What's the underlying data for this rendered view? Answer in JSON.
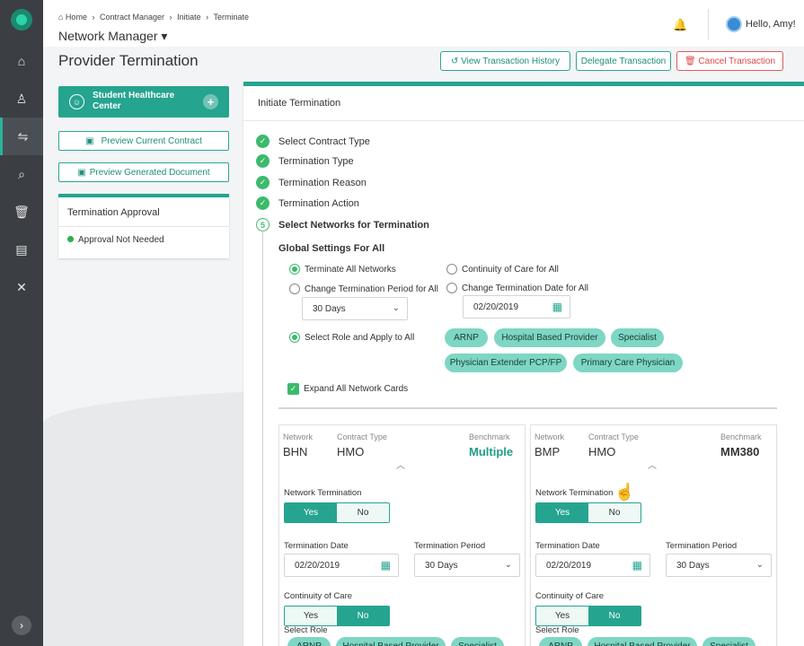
{
  "rail": {
    "items": [
      {
        "icon": "home-icon",
        "glyph": "⌂"
      },
      {
        "icon": "network-icon",
        "glyph": "♙"
      },
      {
        "icon": "transfer-icon",
        "glyph": "⇋"
      },
      {
        "icon": "search-icon",
        "glyph": "⌕"
      },
      {
        "icon": "trash-icon",
        "glyph": "🗑"
      },
      {
        "icon": "document-icon",
        "glyph": "▤"
      },
      {
        "icon": "tools-icon",
        "glyph": "✕"
      }
    ],
    "expand_glyph": "›"
  },
  "header": {
    "breadcrumb": [
      "⌂ Home",
      "›",
      "Contract Manager",
      "›",
      "Initiate",
      "›",
      "Terminate"
    ],
    "network_title": "Network Manager ▾",
    "greeting": "Hello, Amy!"
  },
  "page": {
    "title": "Provider Termination",
    "buttons": {
      "history": "↺  View Transaction History",
      "delegate": "Delegate Transaction",
      "cancel": "🗑  Cancel Transaction"
    }
  },
  "sidebar": {
    "provider_name": "Student Healthcare Center",
    "add_glyph": "+",
    "preview_current": "Preview Current Contract",
    "preview_generated": "Preview Generated Document",
    "approval_title": "Termination Approval",
    "approval_status": "Approval Not Needed"
  },
  "panel": {
    "title": "Initiate Termination",
    "steps": [
      {
        "label": "Select Contract Type",
        "done": true
      },
      {
        "label": "Termination Type",
        "done": true
      },
      {
        "label": "Termination Reason",
        "done": true
      },
      {
        "label": "Termination Action",
        "done": true
      },
      {
        "label": "Select Networks for Termination",
        "done": false,
        "number": "5"
      }
    ],
    "global_title": "Global Settings For All",
    "radios": {
      "terminate_all": "Terminate All Networks",
      "continuity_all": "Continuity of Care for All",
      "change_period": "Change Termination Period for All",
      "change_date": "Change Termination Date for All",
      "select_role": "Select Role and Apply to All"
    },
    "period_value": "30 Days",
    "date_value": "02/20/2019",
    "roles": [
      "ARNP",
      "Hospital Based Provider",
      "Specialist",
      "Physician Extender PCP/FP",
      "Primary Care Physician"
    ],
    "expand_all": "Expand All Network Cards"
  },
  "cards": [
    {
      "network_label": "Network",
      "network": "BHN",
      "contract_label": "Contract Type",
      "contract": "HMO",
      "benchmark_label": "Benchmark",
      "benchmark": "Multiple",
      "term_label": "Network Termination",
      "yes": "Yes",
      "no": "No",
      "termination": "Yes",
      "date_label": "Termination Date",
      "date": "02/20/2019",
      "period_label": "Termination Period",
      "period": "30 Days",
      "coc_label": "Continuity of Care",
      "coc": "No",
      "role_label": "Select Role",
      "roles": [
        "ARNP",
        "Hospital Based Provider",
        "Specialist"
      ]
    },
    {
      "network_label": "Network",
      "network": "BMP",
      "contract_label": "Contract Type",
      "contract": "HMO",
      "benchmark_label": "Benchmark",
      "benchmark": "MM380",
      "term_label": "Network Termination",
      "yes": "Yes",
      "no": "No",
      "termination": "Yes",
      "date_label": "Termination Date",
      "date": "02/20/2019",
      "period_label": "Termination Period",
      "period": "30 Days",
      "coc_label": "Continuity of Care",
      "coc": "No",
      "role_label": "Select Role",
      "roles": [
        "ARNP",
        "Hospital Based Provider",
        "Specialist"
      ]
    }
  ]
}
